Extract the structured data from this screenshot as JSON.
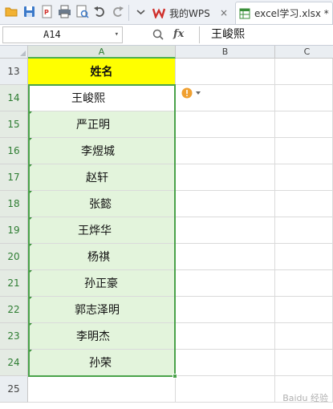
{
  "toolbar": {
    "icons": [
      "open-folder-icon",
      "save-icon",
      "export-pdf-icon",
      "print-icon",
      "print-preview-icon",
      "undo-icon",
      "redo-icon",
      "more-dropdown-icon"
    ],
    "tabs": [
      {
        "label": "我的WPS",
        "icon": "wps-logo-icon",
        "close": "×"
      },
      {
        "label": "excel学习.xlsx *",
        "icon": "spreadsheet-file-icon"
      }
    ]
  },
  "formula_bar": {
    "name_box": "A14",
    "name_box_dropdown": "▾",
    "fx_label": "fx",
    "value": "王峻熙"
  },
  "sheet": {
    "columns": [
      "A",
      "B",
      "C"
    ],
    "active_column": "A",
    "rows": [
      {
        "num": "13",
        "a": "姓名"
      },
      {
        "num": "14",
        "a": "王峻熙"
      },
      {
        "num": "15",
        "a": "严正明"
      },
      {
        "num": "16",
        "a": "李煜城"
      },
      {
        "num": "17",
        "a": "赵轩"
      },
      {
        "num": "18",
        "a": "张懿"
      },
      {
        "num": "19",
        "a": "王烨华"
      },
      {
        "num": "20",
        "a": "杨祺"
      },
      {
        "num": "21",
        "a": "孙正豪"
      },
      {
        "num": "22",
        "a": "郭志泽明"
      },
      {
        "num": "23",
        "a": "李明杰"
      },
      {
        "num": "24",
        "a": "孙荣"
      },
      {
        "num": "25",
        "a": ""
      }
    ]
  },
  "colors": {
    "header_fill": "#ffff00",
    "selection_fill": "#e3f4dc",
    "selection_border": "#4aa24a",
    "error_indicator": "#f0a030"
  }
}
